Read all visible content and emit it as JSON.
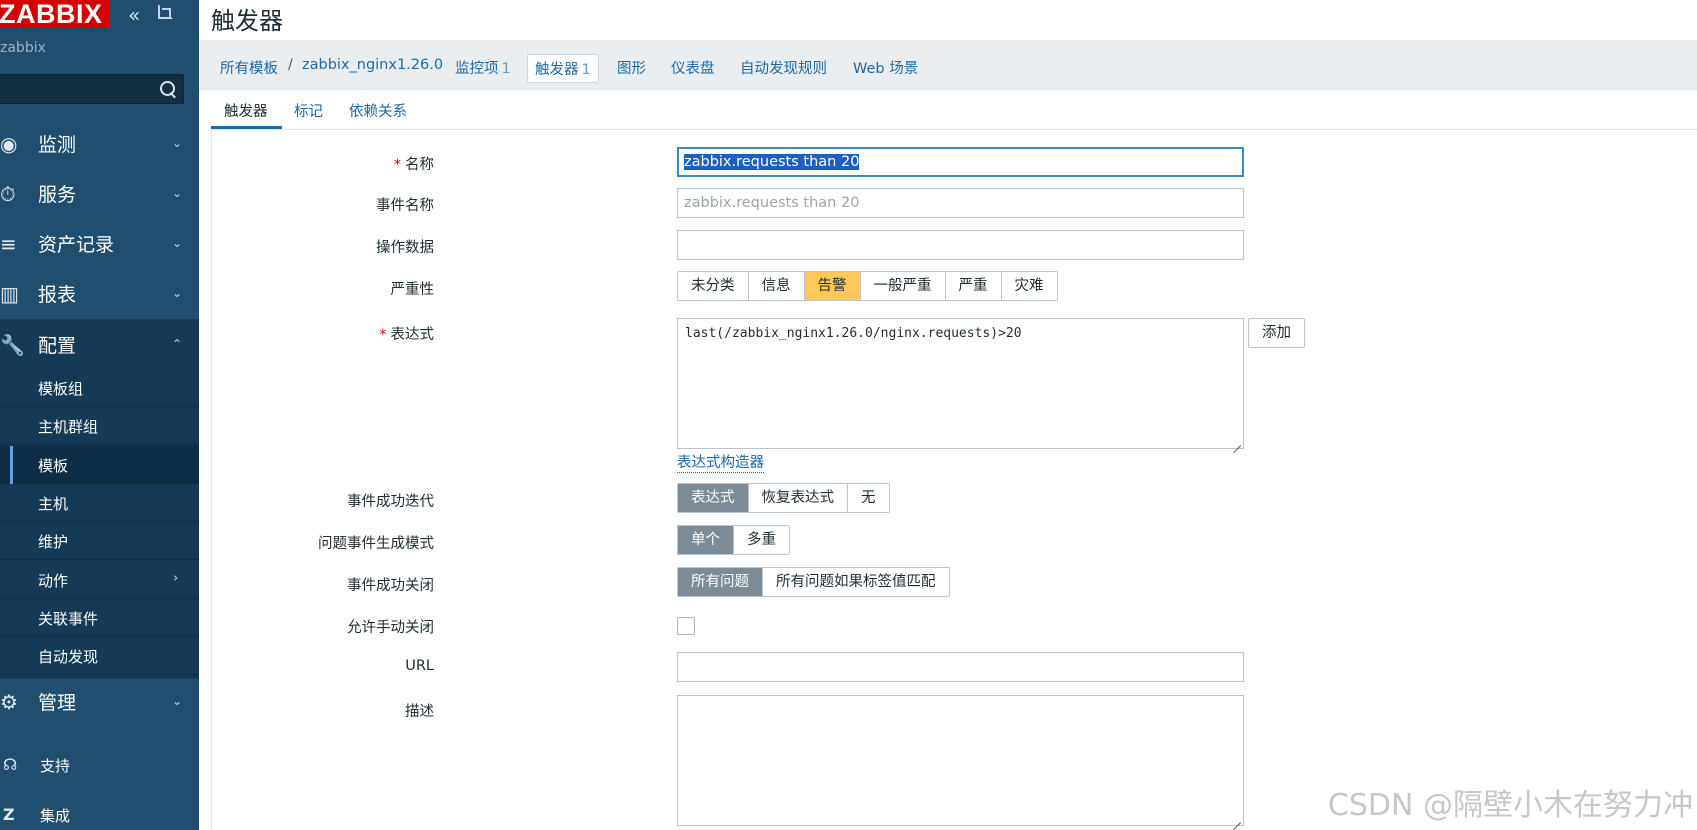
{
  "sidebar": {
    "logo": "ZABBIX",
    "server_name": "zabbix",
    "search_placeholder": "",
    "nav": [
      {
        "label": "监测",
        "icon": "eye-icon"
      },
      {
        "label": "服务",
        "icon": "stopwatch-icon"
      },
      {
        "label": "资产记录",
        "icon": "list-icon"
      },
      {
        "label": "报表",
        "icon": "bar-chart-icon"
      },
      {
        "label": "配置",
        "icon": "wrench-icon"
      }
    ],
    "submenu": [
      "模板组",
      "主机群组",
      "模板",
      "主机",
      "维护",
      "动作",
      "关联事件",
      "自动发现"
    ],
    "admin": {
      "label": "管理",
      "icon": "gear-icon"
    },
    "support": "支持",
    "integrations": "集成"
  },
  "header": {
    "title": "触发器"
  },
  "breadcrumb": {
    "all_templates": "所有模板",
    "separator": "/",
    "template": "zabbix_nginx1.26.0",
    "items": "监控项",
    "items_count": "1",
    "triggers": "触发器",
    "triggers_count": "1",
    "graphs": "图形",
    "dashboards": "仪表盘",
    "discovery": "自动发现规则",
    "web": "Web 场景"
  },
  "tabs": [
    "触发器",
    "标记",
    "依赖关系"
  ],
  "form": {
    "name_label": "名称",
    "name_value": "zabbix.requests than 20",
    "event_name_label": "事件名称",
    "event_name_placeholder": "zabbix.requests than 20",
    "opdata_label": "操作数据",
    "opdata_value": "",
    "severity_label": "严重性",
    "severity_options": [
      "未分类",
      "信息",
      "告警",
      "一般严重",
      "严重",
      "灾难"
    ],
    "severity_selected": "告警",
    "expression_label": "表达式",
    "expression_value": "last(/zabbix_nginx1.26.0/nginx.requests)>20",
    "add_button": "添加",
    "expression_constructor": "表达式构造器",
    "ok_event_label": "事件成功迭代",
    "ok_event_options": [
      "表达式",
      "恢复表达式",
      "无"
    ],
    "ok_event_selected": "表达式",
    "problem_mode_label": "问题事件生成模式",
    "problem_mode_options": [
      "单个",
      "多重"
    ],
    "problem_mode_selected": "单个",
    "ok_close_label": "事件成功关闭",
    "ok_close_options": [
      "所有问题",
      "所有问题如果标签值匹配"
    ],
    "ok_close_selected": "所有问题",
    "manual_close_label": "允许手动关闭",
    "manual_close_checked": false,
    "url_label": "URL",
    "url_value": "",
    "description_label": "描述",
    "description_value": ""
  },
  "watermark": "CSDN @隔壁小木在努力冲",
  "colors": {
    "sidebar_bg": "#1f4e6e",
    "logo_red": "#d40000",
    "link_blue": "#1c69a8",
    "severity_warning": "#ffc859",
    "segment_selected": "#7c8b95"
  }
}
